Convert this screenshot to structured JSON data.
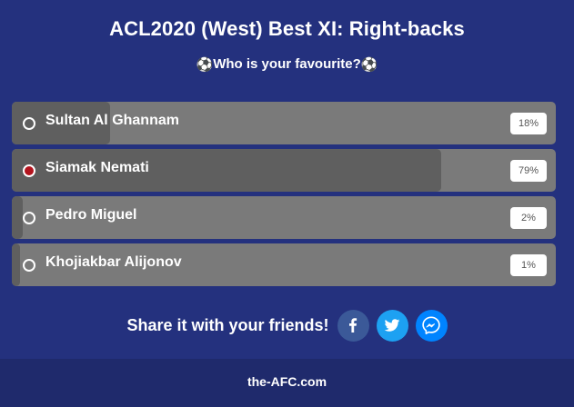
{
  "poll": {
    "title": "ACL2020 (West) Best XI: Right-backs",
    "subtitle": "Who is your favourite?",
    "subtitle_icon": "⚽",
    "options": [
      {
        "label": "Sultan Al Ghannam",
        "percent_text": "18%",
        "percent": 18,
        "selected": false
      },
      {
        "label": "Siamak Nemati",
        "percent_text": "79%",
        "percent": 79,
        "selected": true
      },
      {
        "label": "Pedro Miguel",
        "percent_text": "2%",
        "percent": 2,
        "selected": false
      },
      {
        "label": "Khojiakbar Alijonov",
        "percent_text": "1%",
        "percent": 1,
        "selected": false
      }
    ]
  },
  "share": {
    "text": "Share it with your friends!",
    "buttons": [
      {
        "icon": "facebook-icon",
        "color": "#3b5998"
      },
      {
        "icon": "twitter-icon",
        "color": "#1da1f2"
      },
      {
        "icon": "messenger-icon",
        "color": "#0084ff"
      }
    ]
  },
  "footer": {
    "text": "the-AFC.com"
  },
  "colors": {
    "background": "#24317e",
    "footer_background": "#1f2a6c",
    "bar_track": "#7a7a7a",
    "bar_fill": "#5f5f5f",
    "selected_radio": "#b3141e"
  }
}
